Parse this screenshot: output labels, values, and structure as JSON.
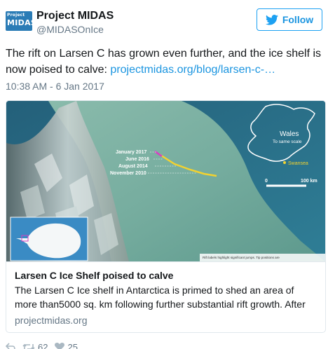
{
  "account": {
    "logo_line1": "Project",
    "logo_line2": "MIDAS",
    "name": "Project MIDAS",
    "handle": "@MIDASOnIce",
    "follow_label": "Follow"
  },
  "tweet": {
    "text_before_link": "The rift on Larsen C has grown even further, and the ice shelf is now poised to calve: ",
    "link_text": "projectmidas.org/blog/larsen-c-…",
    "timestamp": "10:38 AM - 6 Jan 2017"
  },
  "card": {
    "map": {
      "rift_labels": [
        "January 2017",
        "June 2016",
        "August 2014",
        "November 2010"
      ],
      "inset_title": "Wales",
      "inset_subtitle": "To same scale",
      "inset_city": "Swansea",
      "scale_start": "0",
      "scale_end": "100 km",
      "caption": "Rift labels highlight significant jumps. Tip positions are"
    },
    "title": "Larsen C Ice Shelf poised to calve",
    "description": "The Larsen C Ice shelf in Antarctica is primed to shed an area of more than5000 sq. km following further substantial rift growth. After",
    "domain": "projectmidas.org"
  },
  "actions": {
    "retweets": "62",
    "likes": "25"
  },
  "colors": {
    "accent": "#1da1f2",
    "link": "#1b95e0",
    "muted": "#657786",
    "rift_yellow": "#f2d230",
    "rift_magenta": "#d63fc2"
  }
}
